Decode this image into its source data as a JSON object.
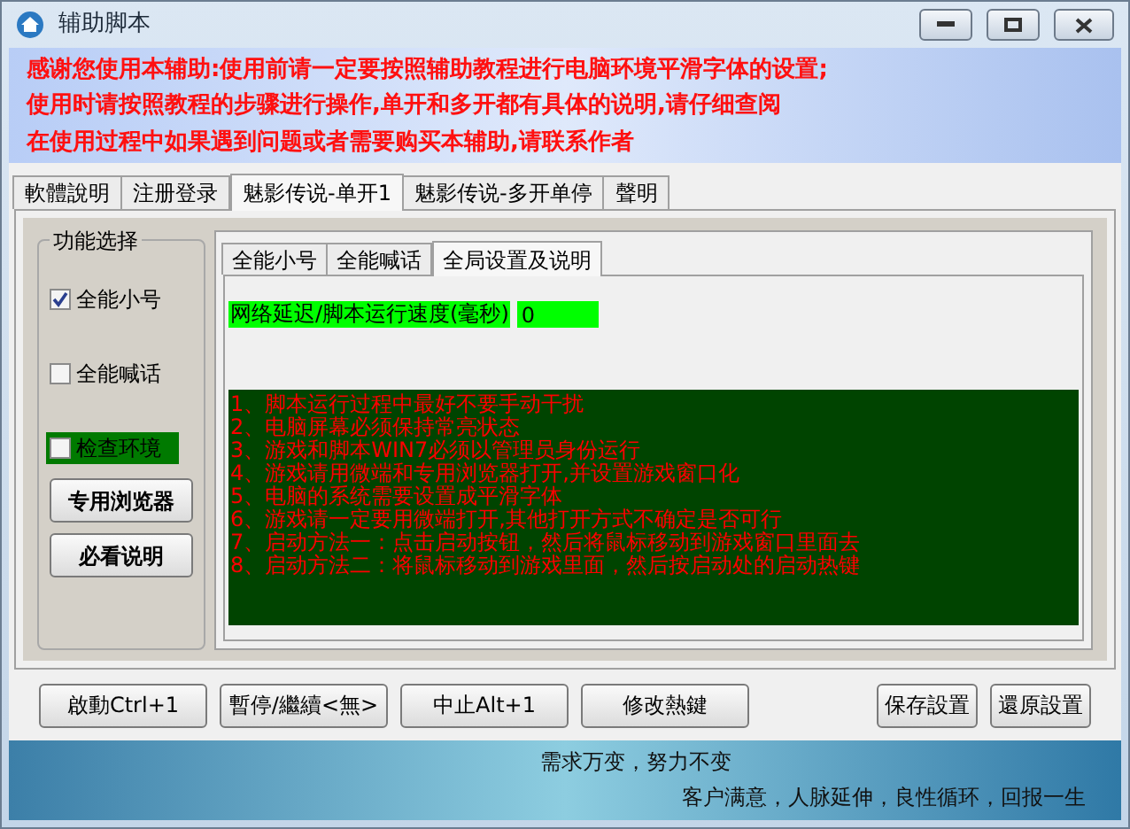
{
  "window": {
    "title": "辅助脚本"
  },
  "banner": {
    "lines": [
      "感谢您使用本辅助:使用前请一定要按照辅助教程进行电脑环境平滑字体的设置;",
      "使用时请按照教程的步骤进行操作,单开和多开都有具体的说明,请仔细查阅",
      "在使用过程中如果遇到问题或者需要购买本辅助,请联系作者"
    ]
  },
  "tabs": [
    {
      "label": "軟體說明",
      "selected": false
    },
    {
      "label": "注册登录",
      "selected": false
    },
    {
      "label": "魅影传说-单开1",
      "selected": true
    },
    {
      "label": "魅影传说-多开单停",
      "selected": false
    },
    {
      "label": "聲明",
      "selected": false
    }
  ],
  "group": {
    "title": "功能选择",
    "checkboxes": [
      {
        "label": "全能小号",
        "checked": true,
        "highlighted": false
      },
      {
        "label": "全能喊话",
        "checked": false,
        "highlighted": false
      },
      {
        "label": "检查环境",
        "checked": false,
        "highlighted": true
      }
    ],
    "buttons": [
      "专用浏览器",
      "必看说明"
    ]
  },
  "inner_tabs": [
    {
      "label": "全能小号",
      "selected": false
    },
    {
      "label": "全能喊话",
      "selected": false
    },
    {
      "label": "全局设置及说明",
      "selected": true
    }
  ],
  "speed_field": {
    "label": "网络延迟/脚本运行速度(毫秒)",
    "value": "0"
  },
  "notes": [
    "1、脚本运行过程中最好不要手动干扰",
    "2、电脑屏幕必须保持常亮状态",
    "3、游戏和脚本WIN7必须以管理员身份运行",
    "4、游戏请用微端和专用浏览器打开,并设置游戏窗口化",
    "5、电脑的系统需要设置成平滑字体",
    "6、游戏请一定要用微端打开,其他打开方式不确定是否可行",
    "7、启动方法一：点击启动按钮，然后将鼠标移动到游戏窗口里面去",
    "8、启动方法二：将鼠标移动到游戏里面，然后按启动处的启动热键"
  ],
  "bottom_buttons": {
    "left": [
      "啟動Ctrl+1",
      "暫停/繼續<無>",
      "中止Alt+1",
      "修改熱鍵"
    ],
    "right": [
      "保存設置",
      "還原設置"
    ]
  },
  "footer": [
    "需求万变，努力不变",
    "客户满意，人脉延伸，良性循环，回报一生"
  ]
}
